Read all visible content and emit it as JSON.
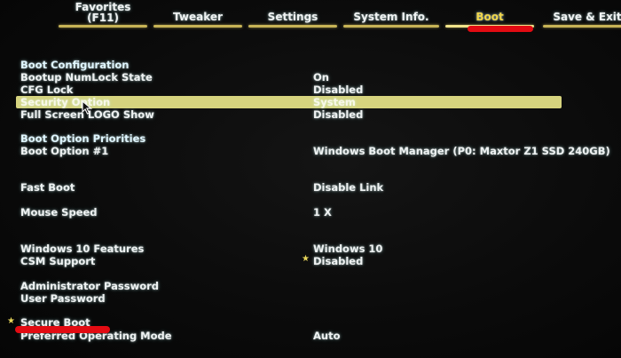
{
  "tabs": [
    {
      "line1": "Favorites",
      "line2": "(F11)",
      "active": false
    },
    {
      "line1": "Tweaker",
      "line2": "",
      "active": false
    },
    {
      "line1": "Settings",
      "line2": "",
      "active": false
    },
    {
      "line1": "System Info.",
      "line2": "",
      "active": false
    },
    {
      "line1": "Boot",
      "line2": "",
      "active": true
    },
    {
      "line1": "Save & Exit",
      "line2": "",
      "active": false
    }
  ],
  "sections": {
    "boot_configuration": "Boot Configuration",
    "boot_option_priorities": "Boot Option Priorities"
  },
  "settings": {
    "bootup_numlock": {
      "label": "Bootup NumLock State",
      "value": "On"
    },
    "cfg_lock": {
      "label": "CFG Lock",
      "value": "Disabled"
    },
    "security_option": {
      "label": "Security Option",
      "value": "System"
    },
    "full_screen_logo": {
      "label": "Full Screen LOGO Show",
      "value": "Disabled"
    },
    "boot_option_1": {
      "label": "Boot Option #1",
      "value": "Windows Boot Manager (P0: Maxtor Z1 SSD 240GB)"
    },
    "fast_boot": {
      "label": "Fast Boot",
      "value": "Disable Link"
    },
    "mouse_speed": {
      "label": "Mouse Speed",
      "value": "1 X"
    },
    "windows_10_features": {
      "label": "Windows 10 Features",
      "value": "Windows 10"
    },
    "csm_support": {
      "label": "CSM Support",
      "value": "Disabled"
    },
    "admin_password": {
      "label": "Administrator Password",
      "value": ""
    },
    "user_password": {
      "label": "User Password",
      "value": ""
    },
    "secure_boot": {
      "label": "Secure Boot",
      "value": ""
    },
    "preferred_os_mode": {
      "label": "Preferred Operating Mode",
      "value": "Auto"
    }
  },
  "icons": {
    "star": "★",
    "cursor": "mouse-pointer-icon"
  },
  "colors": {
    "active_tab": "#f0d64a",
    "tab_underline": "#c7b356",
    "highlight_bar": "#d6d37e",
    "annotation_red": "#e20b12",
    "text": "#eef2f2"
  }
}
